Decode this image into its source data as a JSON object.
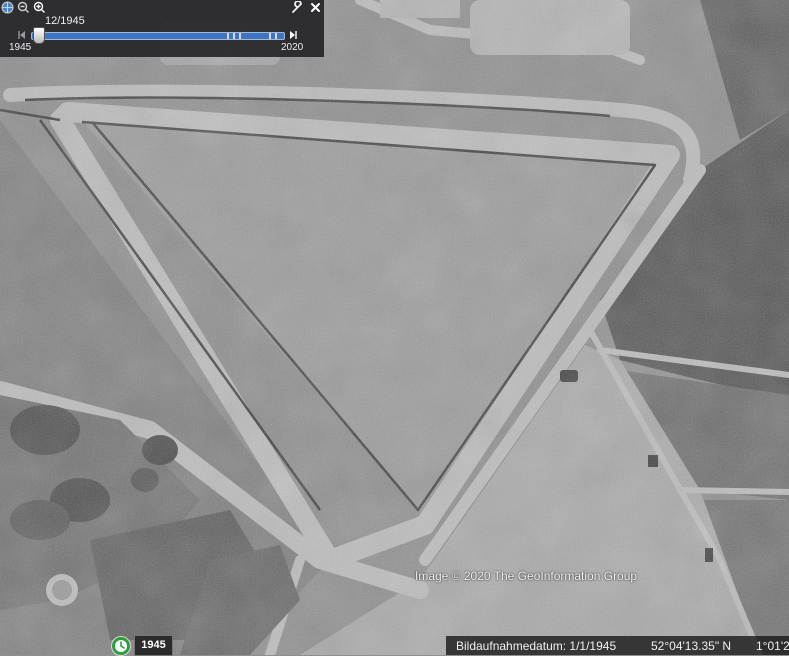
{
  "time_slider": {
    "current_date": "12/1945",
    "start_year": "1945",
    "end_year": "2020"
  },
  "attribution": "Image © 2020 The GeoInformation Group",
  "status": {
    "year_badge": "1945",
    "imagery_date": "Bildaufnahmedatum: 1/1/1945",
    "latitude": "52°04'13.35\" N",
    "longitude": "1°01'2"
  },
  "icons": {
    "panel": [
      "globe-icon",
      "zoom-out-icon",
      "zoom-in-icon",
      "wrench-icon",
      "close-icon"
    ],
    "slider": [
      "step-back-icon",
      "step-forward-icon"
    ],
    "status": [
      "history-clock-icon"
    ]
  },
  "colors": {
    "slider_track": "#3e74c2",
    "panel_bg": "#1c1c1e",
    "history_icon": "#2e9e3c"
  }
}
